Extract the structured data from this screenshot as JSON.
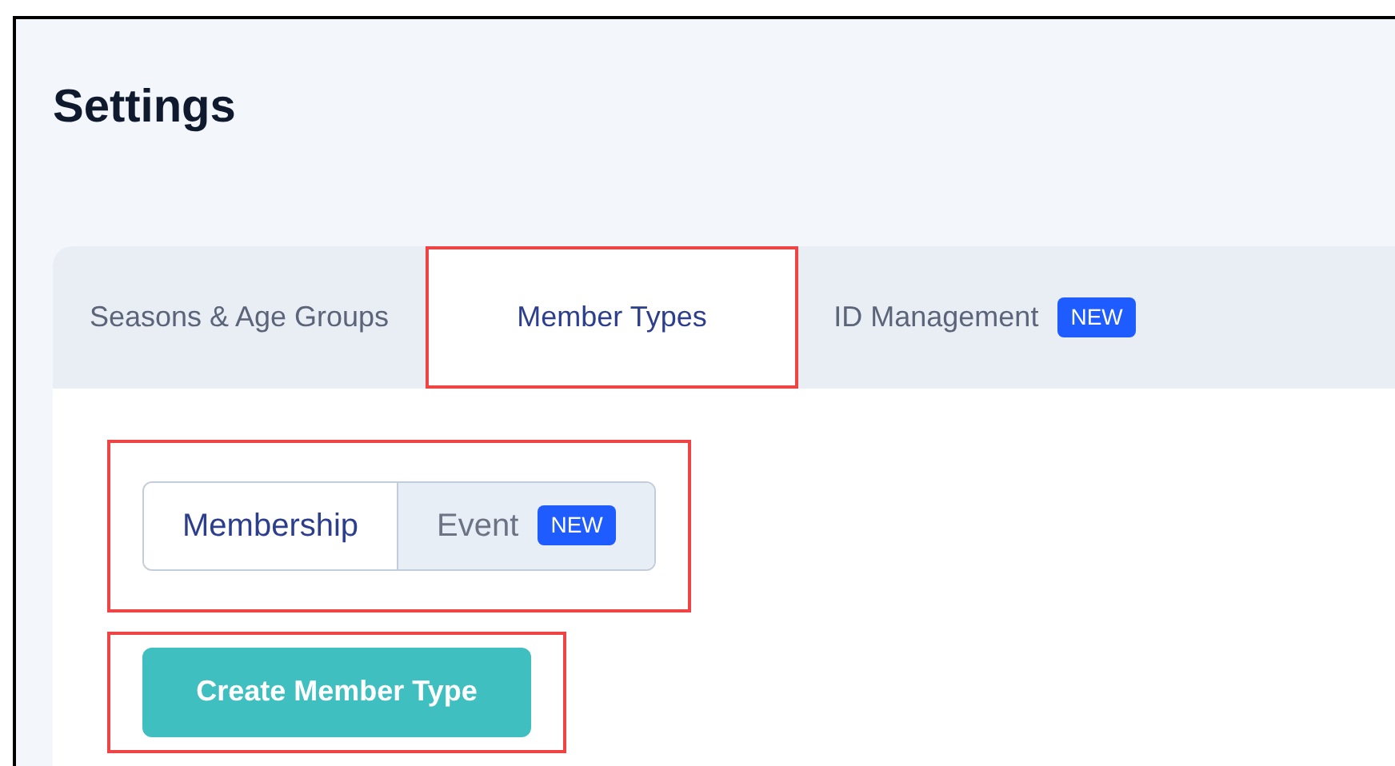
{
  "page": {
    "title": "Settings"
  },
  "tabs": [
    {
      "label": "Seasons & Age Groups",
      "selected": false,
      "highlighted": false
    },
    {
      "label": "Member Types",
      "selected": true,
      "highlighted": true
    },
    {
      "label": "ID Management",
      "selected": false,
      "highlighted": false,
      "badge": "NEW"
    }
  ],
  "type_switch": {
    "highlighted": true,
    "options": [
      {
        "label": "Membership",
        "selected": true
      },
      {
        "label": "Event",
        "selected": false,
        "badge": "NEW"
      }
    ]
  },
  "create_button": {
    "label": "Create Member Type",
    "highlighted": true
  }
}
